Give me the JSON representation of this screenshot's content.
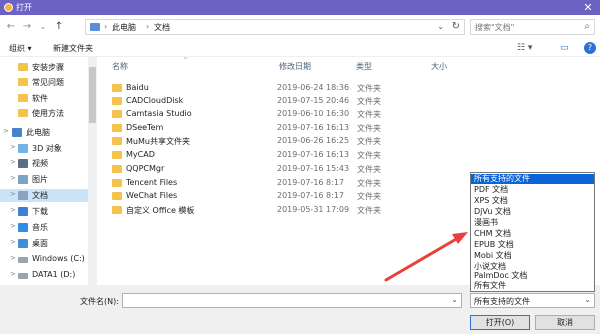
{
  "window": {
    "title": "打开",
    "close_glyph": "✕"
  },
  "nav": {
    "back_glyph": "←",
    "forward_glyph": "→",
    "recent_glyph": "⌄",
    "up_glyph": "↑",
    "breadcrumb": [
      "此电脑",
      "文档"
    ],
    "sep_glyph": "›",
    "dropdown_glyph": "⌄",
    "refresh_glyph": "↻",
    "search_placeholder": "搜索\"文档\"",
    "search_glyph": "⌕"
  },
  "toolbar": {
    "organize": "组织 ▾",
    "new_folder": "新建文件夹",
    "view_glyph": "☷ ▾",
    "pane_glyph": "▭",
    "help_glyph": "?"
  },
  "sidebar": {
    "items": [
      {
        "label": "安装步骤"
      },
      {
        "label": "常见问题"
      },
      {
        "label": "软件"
      },
      {
        "label": "使用方法"
      },
      {
        "label": "此电脑"
      },
      {
        "label": "3D 对象"
      },
      {
        "label": "视频"
      },
      {
        "label": "图片"
      },
      {
        "label": "文档"
      },
      {
        "label": "下载"
      },
      {
        "label": "音乐"
      },
      {
        "label": "桌面"
      },
      {
        "label": "Windows (C:)"
      },
      {
        "label": "DATA1 (D:)"
      }
    ],
    "expand_glyph": ">"
  },
  "columns": {
    "name": "名称",
    "date": "修改日期",
    "type": "类型",
    "size": "大小",
    "sort_glyph": "^"
  },
  "files": [
    {
      "name": "Baidu",
      "date": "2019-06-24 18:36",
      "type": "文件夹"
    },
    {
      "name": "CADCloudDisk",
      "date": "2019-07-15 20:46",
      "type": "文件夹"
    },
    {
      "name": "Camtasia Studio",
      "date": "2019-06-10 16:30",
      "type": "文件夹"
    },
    {
      "name": "DSeeTem",
      "date": "2019-07-16 16:13",
      "type": "文件夹"
    },
    {
      "name": "MuMu共享文件夹",
      "date": "2019-06-26 16:25",
      "type": "文件夹"
    },
    {
      "name": "MyCAD",
      "date": "2019-07-16 16:13",
      "type": "文件夹"
    },
    {
      "name": "QQPCMgr",
      "date": "2019-07-16 15:43",
      "type": "文件夹"
    },
    {
      "name": "Tencent Files",
      "date": "2019-07-16 8:17",
      "type": "文件夹"
    },
    {
      "name": "WeChat Files",
      "date": "2019-07-16 8:17",
      "type": "文件夹"
    },
    {
      "name": "自定义 Office 模板",
      "date": "2019-05-31 17:09",
      "type": "文件夹"
    }
  ],
  "bottom": {
    "filename_label": "文件名(N):",
    "filename_value": "",
    "filetype_value": "所有支持的文件",
    "dropdown_glyph": "⌄",
    "open_button": "打开(O)",
    "cancel_button": "取消"
  },
  "filetype_options": [
    "所有支持的文件",
    "PDF 文档",
    "XPS 文档",
    "DjVu 文档",
    "漫画书",
    "CHM 文档",
    "EPUB 文档",
    "Mobi 文档",
    "小说文档",
    "PalmDoc 文档",
    "所有文件"
  ],
  "colors": {
    "titlebar": "#6b63c4",
    "selection": "#0a64d8",
    "folder": "#f3c34d",
    "arrow": "#e8403a"
  }
}
